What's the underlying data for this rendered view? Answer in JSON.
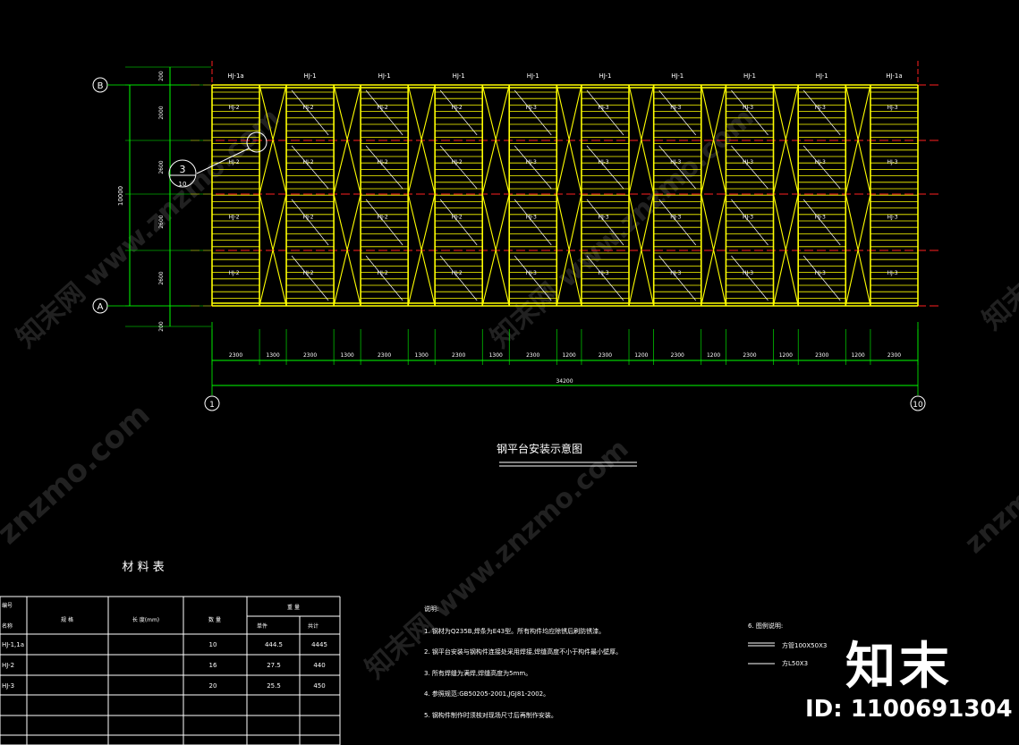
{
  "grid": {
    "axis_b": "B",
    "axis_a": "A",
    "axis_1": "1",
    "axis_10": "10"
  },
  "left_dims": [
    "200",
    "2000",
    "2600",
    "2600",
    "2600",
    "200"
  ],
  "total_height_dim": "10000",
  "truss_labels": [
    "HJ-1a",
    "HJ-1",
    "HJ-1",
    "HJ-1",
    "HJ-1",
    "HJ-1",
    "HJ-1",
    "HJ-1",
    "HJ-1",
    "HJ-1a"
  ],
  "panel_rows": [
    [
      "HJ-2",
      "HJ-2",
      "HJ-2",
      "HJ-2",
      "HJ-3",
      "HJ-3",
      "HJ-3",
      "HJ-3",
      "HJ-3",
      "HJ-3"
    ],
    [
      "HJ-2",
      "HJ-2",
      "HJ-2",
      "HJ-2",
      "HJ-3",
      "HJ-3",
      "HJ-3",
      "HJ-3",
      "HJ-3",
      "HJ-3"
    ],
    [
      "HJ-2",
      "HJ-2",
      "HJ-2",
      "HJ-2",
      "HJ-3",
      "HJ-3",
      "HJ-3",
      "HJ-3",
      "HJ-3",
      "HJ-3"
    ],
    [
      "HJ-2",
      "HJ-2",
      "HJ-2",
      "HJ-2",
      "HJ-3",
      "HJ-3",
      "HJ-3",
      "HJ-3",
      "HJ-3",
      "HJ-3"
    ]
  ],
  "bottom_dims": [
    "2300",
    "1300",
    "2300",
    "1300",
    "2300",
    "1300",
    "2300",
    "1300",
    "2300",
    "1200",
    "2300",
    "1200",
    "2300",
    "1200",
    "2300",
    "1200",
    "2300",
    "1200",
    "2300"
  ],
  "total_width_dim": "34200",
  "detail_callout": {
    "top": "3",
    "bottom": "10"
  },
  "drawing_title": "钢平台安装示意图",
  "material_table": {
    "title": "材   料   表",
    "headers": {
      "col1_top": "编号",
      "col1_bottom": "名称",
      "col2": "规   格",
      "col3": "长   度(mm)",
      "col4": "数   量",
      "weight_group": "重   量",
      "weight_unit": "单件",
      "weight_total": "共计"
    },
    "rows": [
      {
        "id": "HJ-1,1a",
        "spec": "",
        "length": "",
        "qty": "10",
        "unit": "444.5",
        "total": "4445"
      },
      {
        "id": "HJ-2",
        "spec": "",
        "length": "",
        "qty": "16",
        "unit": "27.5",
        "total": "440"
      },
      {
        "id": "HJ-3",
        "spec": "",
        "length": "",
        "qty": "20",
        "unit": "25.5",
        "total": "450"
      },
      {
        "id": "",
        "spec": "",
        "length": "",
        "qty": "",
        "unit": "",
        "total": ""
      },
      {
        "id": "",
        "spec": "",
        "length": "",
        "qty": "",
        "unit": "",
        "total": ""
      },
      {
        "id": "",
        "spec": "",
        "length": "",
        "qty": "",
        "unit": "",
        "total": ""
      }
    ]
  },
  "notes": {
    "heading": "说明:",
    "items": [
      "1. 钢材为Q235B,焊条为E43型。所有构件均应除锈后刷防锈漆。",
      "2. 钢平台安装与钢构件连接处采用焊接,焊缝高度不小于构件最小壁厚。",
      "3. 所有焊缝为满焊,焊缝高度为5mm。",
      "4. 参照规范:GB50205-2001,JGJ81-2002。",
      "5. 钢构件制作时须核对现场尺寸后再制作安装。"
    ]
  },
  "legend": {
    "heading": "6. 图例说明:",
    "items": [
      {
        "label": "方管100X50X3"
      },
      {
        "label": "方L50X3"
      }
    ]
  },
  "watermark": {
    "text_1": "知末网 www.znzmo.com",
    "text_2": "znzmo.com",
    "brand": "知末",
    "id_text": "ID: 1100691304"
  },
  "colors": {
    "truss": "#ffff00",
    "dimension": "#00ff00",
    "axis": "#ff2020",
    "text": "#ffffff",
    "background": "#000000"
  }
}
